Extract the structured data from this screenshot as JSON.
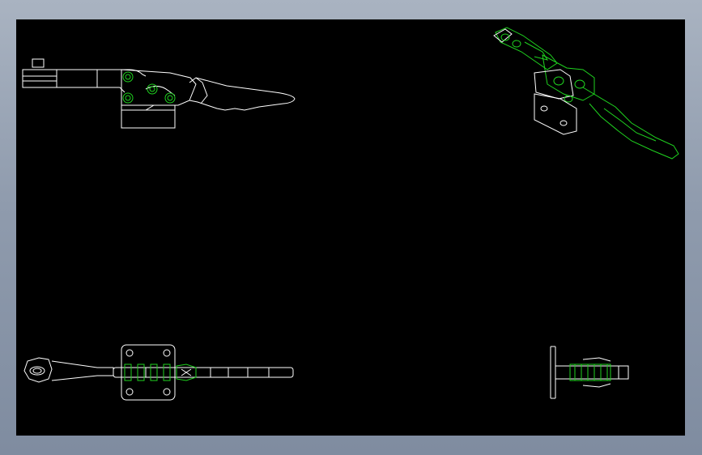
{
  "window": {
    "background": "#8e9aab"
  },
  "canvas": {
    "background": "#000000",
    "line_color": "#ffffff",
    "accent_color": "#1fd21f"
  },
  "views": [
    {
      "id": "front-view"
    },
    {
      "id": "isometric-view"
    },
    {
      "id": "top-view"
    },
    {
      "id": "side-view"
    }
  ],
  "status": {
    "tab": "",
    "scale": "",
    "tab_color": "#ffffff",
    "scale_color": "#e040e0"
  }
}
